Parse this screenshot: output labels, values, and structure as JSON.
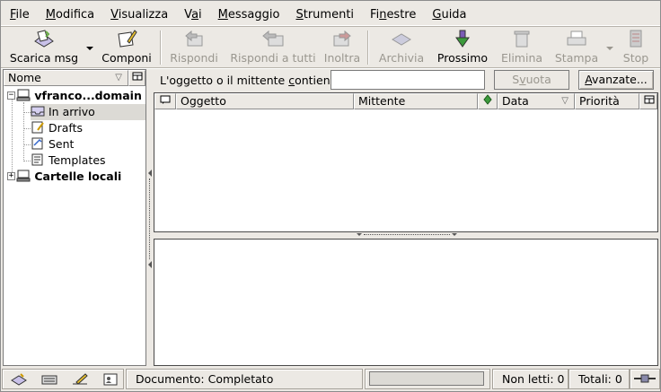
{
  "menubar": {
    "items": [
      {
        "pre": "",
        "u": "F",
        "post": "ile"
      },
      {
        "pre": "",
        "u": "M",
        "post": "odifica"
      },
      {
        "pre": "",
        "u": "V",
        "post": "isualizza"
      },
      {
        "pre": "V",
        "u": "a",
        "post": "i"
      },
      {
        "pre": "",
        "u": "M",
        "post": "essaggio"
      },
      {
        "pre": "",
        "u": "S",
        "post": "trumenti"
      },
      {
        "pre": "Fi",
        "u": "n",
        "post": "estre"
      },
      {
        "pre": "",
        "u": "G",
        "post": "uida"
      }
    ]
  },
  "toolbar": {
    "get_msg": "Scarica msg",
    "compose": "Componi",
    "reply": "Rispondi",
    "reply_all": "Rispondi a tutti",
    "forward": "Inoltra",
    "archive": "Archivia",
    "next": "Prossimo",
    "delete": "Elimina",
    "print": "Stampa",
    "stop": "Stop"
  },
  "folder_pane": {
    "header": "Nome",
    "account": "vfranco...domain",
    "folders": [
      "In arrivo",
      "Drafts",
      "Sent",
      "Templates"
    ],
    "local": "Cartelle locali"
  },
  "search": {
    "label_pre": "L'oggetto o il mittente ",
    "label_u": "c",
    "label_post": "ontiene:",
    "value": "",
    "clear_pre": "S",
    "clear_u": "v",
    "clear_post": "uota",
    "advanced_pre": "",
    "advanced_u": "A",
    "advanced_post": "vanzate..."
  },
  "columns": {
    "subject": "Oggetto",
    "sender": "Mittente",
    "date": "Data",
    "priority": "Priorità"
  },
  "status": {
    "document": "Documento: Completato",
    "unread": "Non letti: 0",
    "total": "Totali: 0"
  },
  "colors": {
    "chrome": "#ece9e4",
    "selected_row": "#dcdad5"
  }
}
